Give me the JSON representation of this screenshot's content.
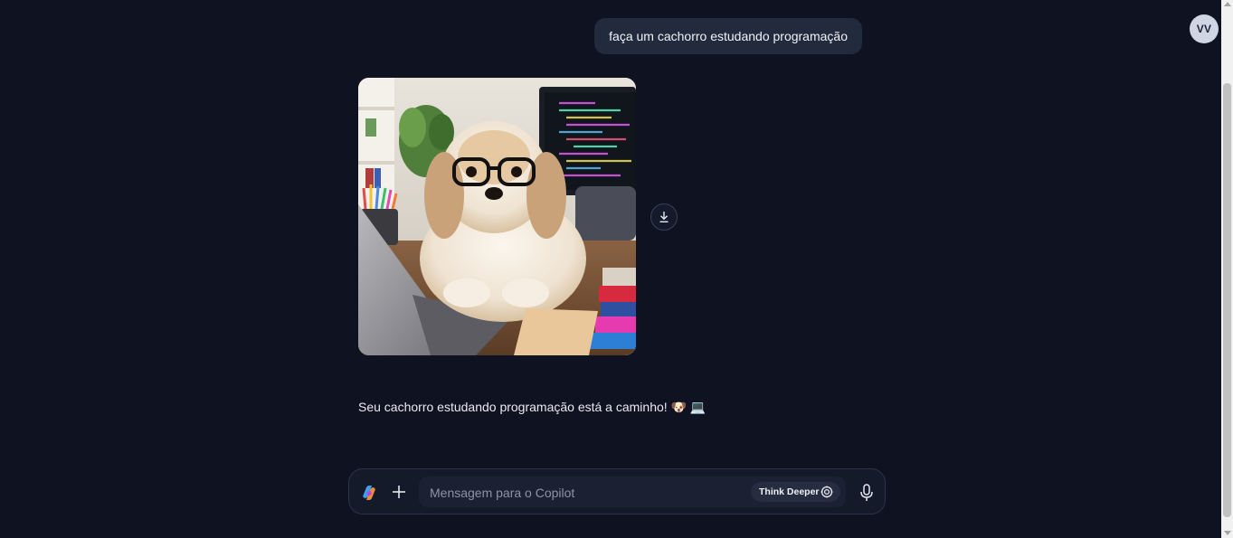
{
  "user": {
    "avatar_initials": "VV"
  },
  "conversation": {
    "user_message": "faça um cachorro estudando programação",
    "assistant_message": "Seu cachorro estudando programação está a caminho! 🐶 💻"
  },
  "image": {
    "alt": "faça um cachorro estudando programação"
  },
  "composer": {
    "placeholder": "Mensagem para o Copilot",
    "value": "",
    "think_deeper_label": "Think Deeper"
  },
  "icons": {
    "download": "download-icon",
    "plus": "plus-icon",
    "mic": "microphone-icon",
    "think": "think-deeper-icon",
    "logo": "copilot-logo"
  },
  "colors": {
    "background": "#0f1220",
    "bubble": "#222a3e",
    "composer": "#151a2b"
  }
}
